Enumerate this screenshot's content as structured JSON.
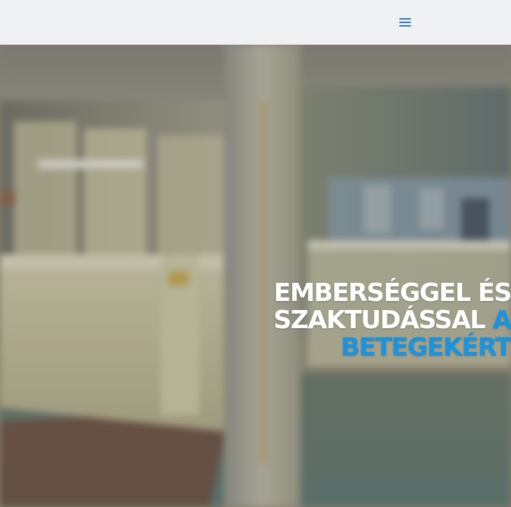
{
  "header": {
    "menu_icon": "hamburger-menu-icon",
    "accent_color": "#2f72c7"
  },
  "hero": {
    "background_image": "blurred-hospital-corridor-reception-desk",
    "headline": {
      "line1": "EMBERSÉGGEL ÉS",
      "line2_white": "SZAKTUDÁSSAL ",
      "line2_accent": "A",
      "line3_accent": "BETEGEKÉRT"
    },
    "text_color": "#ffffff",
    "accent_color": "#1a93e0"
  }
}
